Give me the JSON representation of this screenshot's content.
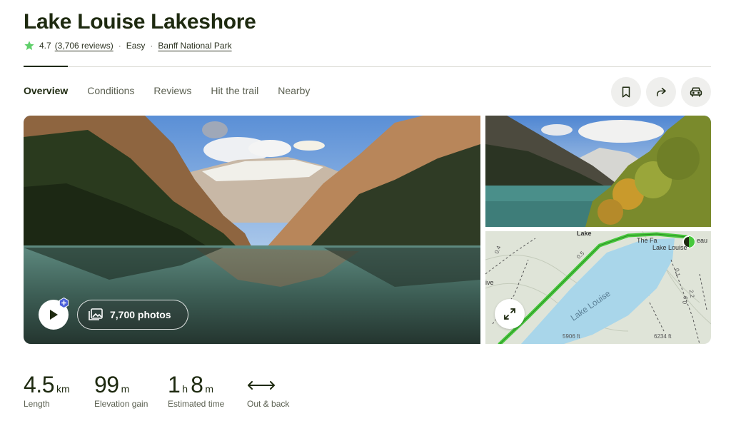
{
  "trail": {
    "title": "Lake Louise Lakeshore",
    "rating": "4.7",
    "reviews": "(3,706 reviews)",
    "difficulty": "Easy",
    "park": "Banff National Park"
  },
  "tabs": [
    {
      "label": "Overview",
      "active": true
    },
    {
      "label": "Conditions"
    },
    {
      "label": "Reviews"
    },
    {
      "label": "Hit the trail"
    },
    {
      "label": "Nearby"
    }
  ],
  "actions": [
    "bookmark-icon",
    "share-icon",
    "car-icon"
  ],
  "media": {
    "photos_label": "7,700 photos"
  },
  "map": {
    "lake_label": "Lake Louise",
    "label_the_fa": "The Fa",
    "label_eau": "eau",
    "label_lake_louise": "Lake Louise",
    "label_lake": "Lake",
    "label_ive": "ive",
    "elev_1": "5906 ft",
    "elev_2": "6234 ft",
    "dist_05": "0.5",
    "dist_04": "0.4",
    "dist_01": "0.1",
    "dist_22": "2.2",
    "dist_09": "0.9"
  },
  "stats": {
    "length_value": "4.5",
    "length_unit": "km",
    "length_label": "Length",
    "elev_value": "99",
    "elev_unit": "m",
    "elev_label": "Elevation gain",
    "time_h_value": "1",
    "time_h_unit": "h",
    "time_m_value": "8",
    "time_m_unit": "m",
    "time_label": "Estimated time",
    "route_label": "Out & back"
  },
  "colors": {
    "brand_text": "#1e2a10",
    "star": "#5fcf6a",
    "trail": "#47c83c",
    "lake": "#a9d6ea"
  }
}
